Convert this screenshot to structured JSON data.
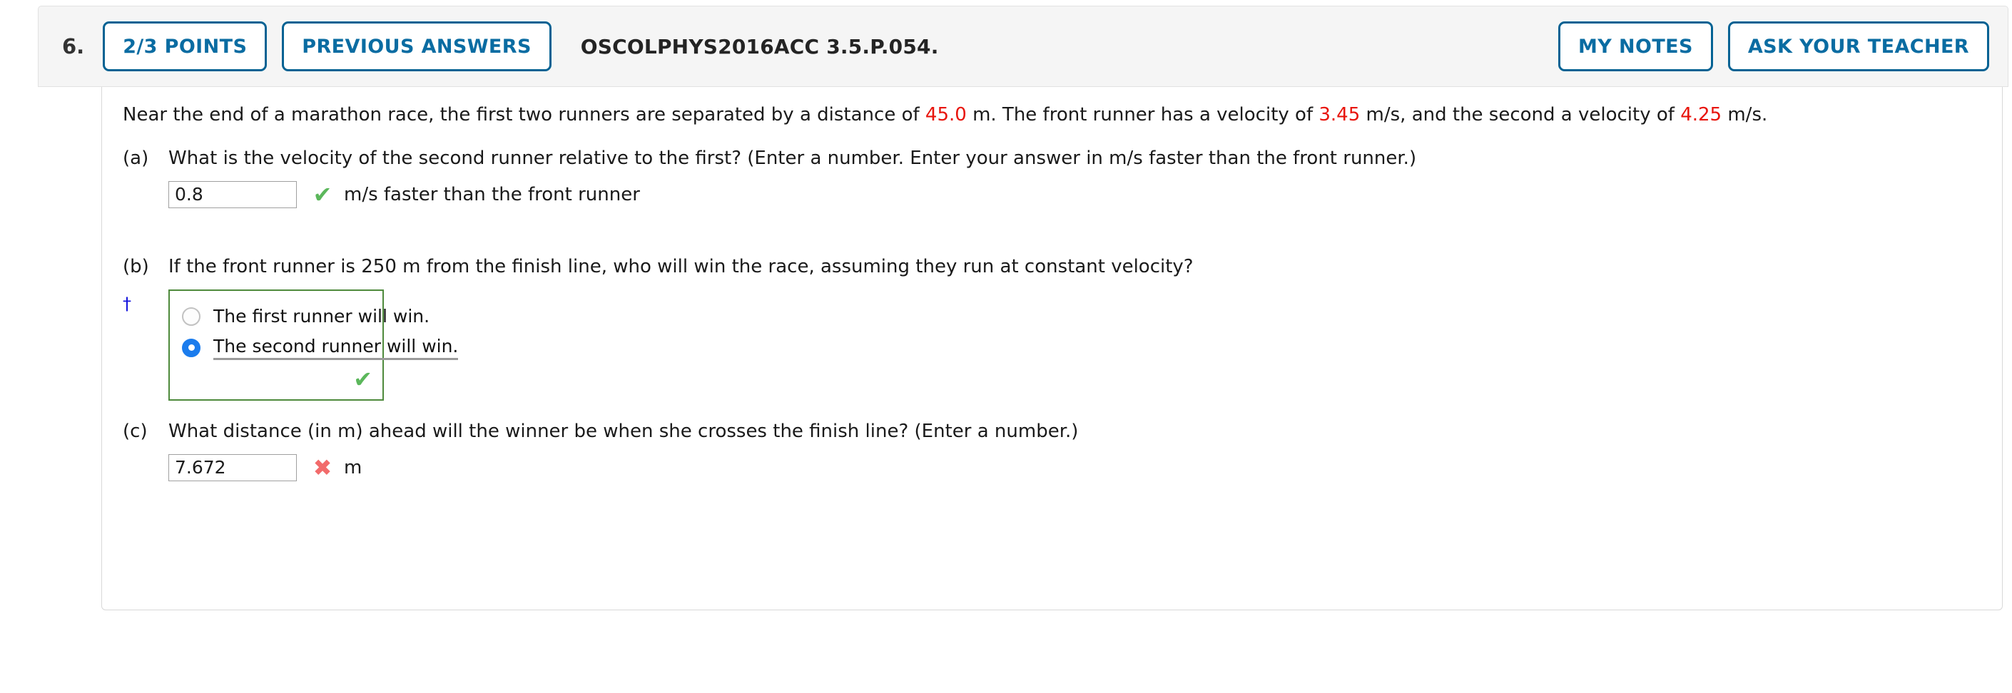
{
  "header": {
    "question_number": "6.",
    "points_label": "2/3 POINTS",
    "previous_answers_label": "PREVIOUS ANSWERS",
    "question_code": "OSCOLPHYS2016ACC 3.5.P.054.",
    "my_notes_label": "MY NOTES",
    "ask_teacher_label": "ASK YOUR TEACHER"
  },
  "problem": {
    "stem_part1": "Near the end of a marathon race, the first two runners are separated by a distance of ",
    "stem_value1": "45.0",
    "stem_part2": " m. The front runner has a velocity of ",
    "stem_value2": "3.45",
    "stem_part3": " m/s, and the second a velocity of ",
    "stem_value3": "4.25",
    "stem_part4": " m/s."
  },
  "parts": [
    {
      "label": "(a)",
      "question": "What is the velocity of the second runner relative to the first? (Enter a number. Enter your answer in m/s faster than the front runner.)",
      "answer_value": "0.8",
      "answer_placeholder": "",
      "mark": "✔",
      "mark_status": "correct",
      "unit": "m/s faster than the front runner"
    },
    {
      "label": "(b)",
      "question": "If the front runner is 250 m from the finish line, who will win the race, assuming they run at constant velocity?",
      "choices": [
        {
          "text": "The first runner will win.",
          "selected": false
        },
        {
          "text": "The second runner will win.",
          "selected": true
        }
      ],
      "mark": "✔",
      "mark_status": "correct"
    },
    {
      "label": "(c)",
      "question": "What distance (in m) ahead will the winner be when she crosses the finish line? (Enter a number.)",
      "answer_value": "7.672",
      "answer_placeholder": "",
      "mark": "✖",
      "mark_status": "incorrect",
      "unit": "m"
    }
  ],
  "footnote": {
    "symbol": "†"
  },
  "colors": {
    "accent_blue": "#046293",
    "value_red": "#e8140c",
    "correct_green": "#5bb75b",
    "incorrect_red": "#f26b6b",
    "box_green": "#4e8a3c",
    "radio_blue": "#1b7ced",
    "footnote_blue": "#1414dd"
  }
}
